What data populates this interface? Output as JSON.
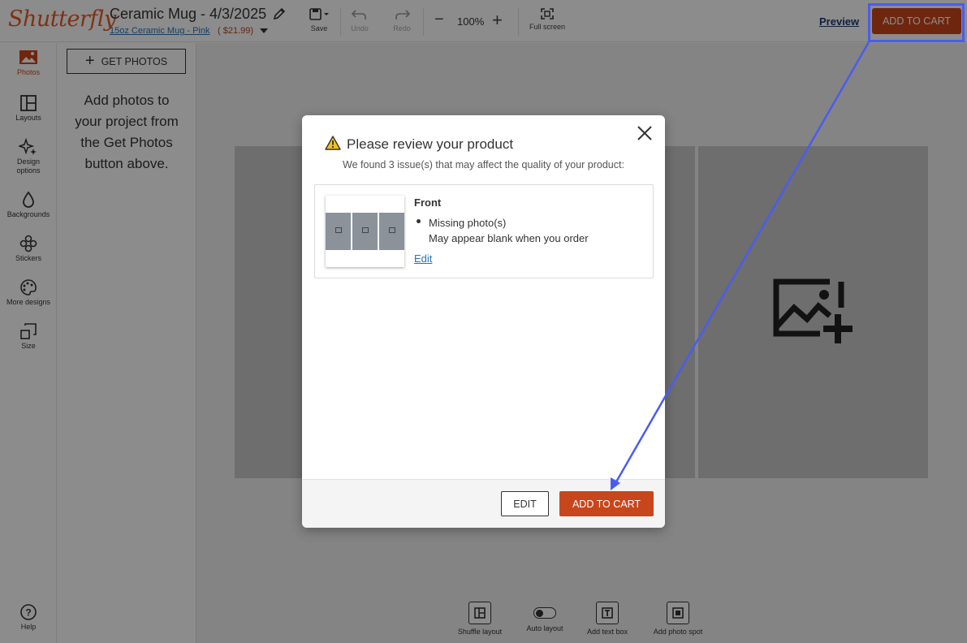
{
  "brand": {
    "logo": "Shutterfly",
    "accent": "#c8461b",
    "annotation_color": "#4a5cf0"
  },
  "header": {
    "project_title": "Ceramic Mug - 4/3/2025",
    "product_link": "15oz Ceramic Mug - Pink",
    "product_price": "( $21.99)",
    "save_label": "Save",
    "undo_label": "Undo",
    "redo_label": "Redo",
    "zoom_level": "100%",
    "fullscreen_label": "Full screen",
    "preview_label": "Preview",
    "add_to_cart_label": "ADD TO CART"
  },
  "sidebar": {
    "items": [
      {
        "label": "Photos",
        "icon": "photo-icon",
        "active": true
      },
      {
        "label": "Layouts",
        "icon": "layout-icon"
      },
      {
        "label": "Design options",
        "icon": "sparkle-icon"
      },
      {
        "label": "Backgrounds",
        "icon": "drop-icon"
      },
      {
        "label": "Stickers",
        "icon": "sticker-icon"
      },
      {
        "label": "More designs",
        "icon": "palette-icon"
      },
      {
        "label": "Size",
        "icon": "resize-icon"
      },
      {
        "label": "Help",
        "icon": "help-icon"
      }
    ]
  },
  "panel": {
    "get_photos_label": "GET PHOTOS",
    "empty_text_lines": [
      "Add photos to",
      "your project from",
      "the Get Photos",
      "button above."
    ]
  },
  "toolbar_bottom": {
    "shuffle_label": "Shuffle layout",
    "auto_label": "Auto layout",
    "text_box_label": "Add text box",
    "photo_spot_label": "Add photo spot"
  },
  "modal": {
    "title": "Please review your product",
    "subtitle": "We found 3 issue(s) that may affect the quality of your product:",
    "issue": {
      "heading": "Front",
      "problem": "Missing photo(s)",
      "detail": "May appear blank when you order",
      "edit_link": "Edit"
    },
    "edit_button": "EDIT",
    "add_to_cart_button": "ADD TO CART"
  }
}
